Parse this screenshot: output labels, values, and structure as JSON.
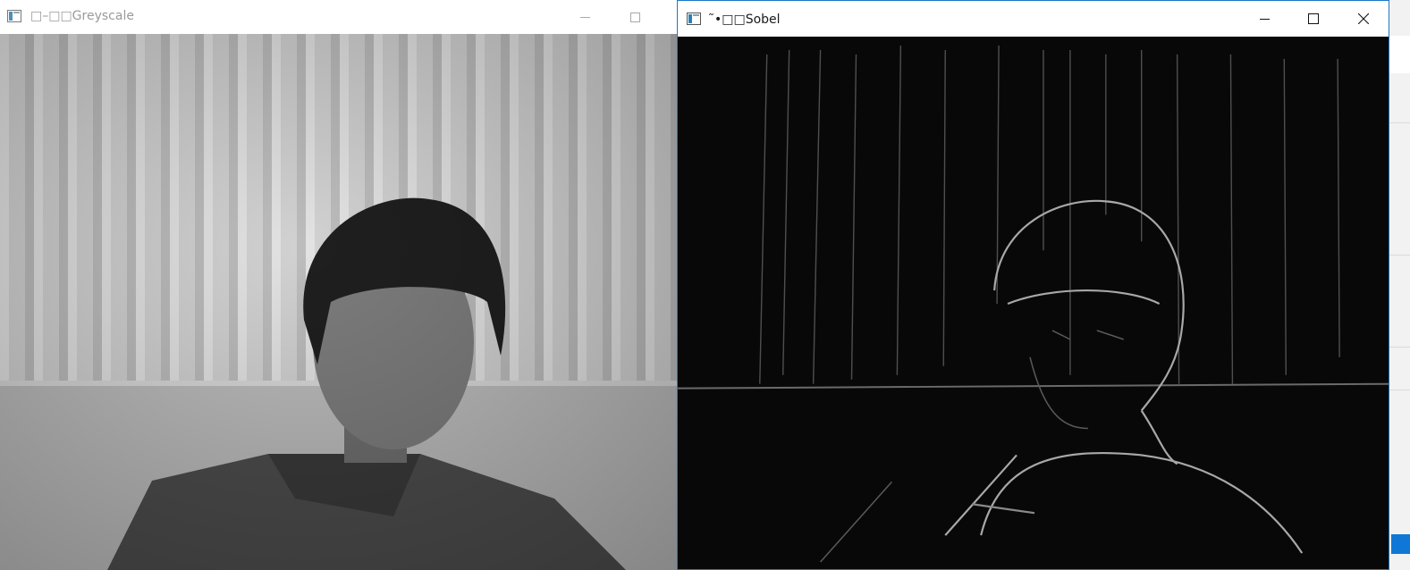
{
  "windows": {
    "greyscale": {
      "title": "□–□□Greyscale",
      "state": "inactive",
      "controls": [
        "minimize",
        "maximize"
      ]
    },
    "sobel": {
      "title": "˜•□□Sobel",
      "state": "active",
      "controls": [
        "minimize",
        "maximize",
        "close"
      ]
    }
  },
  "icons": {
    "window_icon": "app-window-icon",
    "minimize": "minimize-icon",
    "maximize": "maximize-icon",
    "close": "close-icon"
  },
  "colors": {
    "active_border": "#1979ca",
    "greyscale_background": "#c9c9c9",
    "sobel_background": "#080808"
  }
}
